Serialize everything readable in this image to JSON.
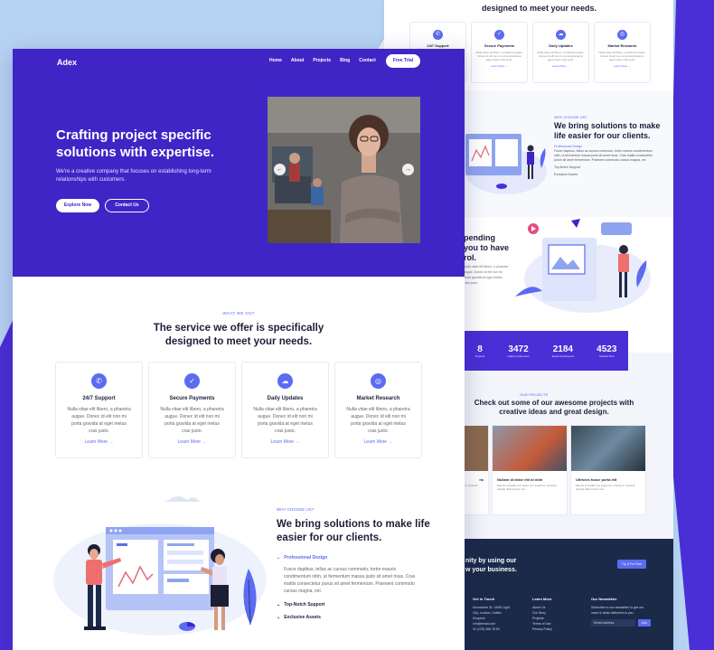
{
  "colors": {
    "primary": "#3f25c6",
    "accent": "#5b6cf0",
    "footer": "#1c2a4a"
  },
  "back": {
    "heading": "designed to meet your needs.",
    "cards": [
      {
        "icon": "phone-icon",
        "title": "24/7 Support",
        "desc": "Nulla vitae elit libero, a pharetra augue. Donec id elit non mi porta gravida at eget metus cras justo.",
        "link": "Learn More →"
      },
      {
        "icon": "shield-icon",
        "title": "Secure Payments",
        "desc": "Nulla vitae elit libero, a pharetra augue. Donec id elit non mi porta gravida at eget metus cras justo.",
        "link": "Learn More →"
      },
      {
        "icon": "cloud-icon",
        "title": "Daily Updates",
        "desc": "Nulla vitae elit libero, a pharetra augue. Donec id elit non mi porta gravida at eget metus cras justo.",
        "link": "Learn More →"
      },
      {
        "icon": "chart-icon",
        "title": "Market Research",
        "desc": "Nulla vitae elit libero, a pharetra augue. Donec id elit non mi porta gravida at eget metus cras justo.",
        "link": "Learn More →"
      }
    ],
    "why_small": "WHY CHOOSE US?",
    "why_title": "We bring solutions to make life easier for our clients.",
    "why_list": [
      "Professional Design",
      "Fusce dapibus, tellus ac cursus commodo, tortor mauris condimentum nibh, ut fermentum massa justo sit amet risus. Cras mattis consectetur purus sit amet fermentum. Praesent commodo cursus magna, vel.",
      "Top-Notch Support",
      "Exclusive Assets"
    ],
    "pend_title": "pending\nyou to have\nrol.",
    "pend_desc": "Nulla vitae elit libero, a pharetra augue. Donec id elit non mi porta gravida at eget metus cras justo.",
    "stats": [
      {
        "n": "8",
        "c": "Projects"
      },
      {
        "n": "3472",
        "c": "Happy Customers"
      },
      {
        "n": "2184",
        "c": "Expert Employees"
      },
      {
        "n": "4523",
        "c": "Awards Won"
      }
    ],
    "proj_small": "OUR PROJECTS",
    "proj_title": "Check out some of our awesome projects with creative ideas and great design.",
    "projects": [
      {
        "t": "ns",
        "d": "Mauris convallis non ligula non interdum. Gravida mauris."
      },
      {
        "t": "Nullam id dolor elit id nibh",
        "d": "Mauris convallis non ligula non interdum. Gravida aufugit ullamcorper nisi."
      },
      {
        "t": "Ultricies fusce porta elit",
        "d": "Mauris convallis non ligula non interdum. Gravida aufugit ullamcorper nisi."
      }
    ],
    "footer_cta": "nity by using our\nw your business.",
    "footer_btn": "Try It For Free",
    "footer_cols": [
      {
        "h": "Get in Touch",
        "items": [
          "Moonshine St. 14/05 Light City, London, United Kingdom",
          "info@email.com",
          "00 (123) 456 78 90"
        ]
      },
      {
        "h": "Learn More",
        "items": [
          "About Us",
          "Our Story",
          "Projects",
          "Terms of Use",
          "Privacy Policy"
        ]
      },
      {
        "h": "Our Newsletter",
        "items": [
          "Subscribe to our newsletter to get our news & deals delivered to you.",
          "Email Address",
          "Join"
        ]
      }
    ]
  },
  "front": {
    "logo": "Adex",
    "nav": [
      "Home",
      "About",
      "Projects",
      "Blog",
      "Contact"
    ],
    "trial": "Free Trial",
    "hero_title": "Crafting project specific solutions with expertise.",
    "hero_desc": "We're a creative company that focuses on establishing long-term relationships with customers.",
    "btn_explore": "Explore Now",
    "btn_contact": "Contact Us",
    "arrow_left": "←",
    "arrow_right": "→",
    "svc_small": "WHAT WE DO?",
    "svc_title": "The service we offer is specifically designed to meet your needs.",
    "cards": [
      {
        "icon": "✆",
        "title": "24/7 Support",
        "desc": "Nulla vitae elit libero, a pharetra augue. Donec id elit non mi porta gravida at eget metus cras justo.",
        "link": "Learn More →"
      },
      {
        "icon": "✓",
        "title": "Secure Payments",
        "desc": "Nulla vitae elit libero, a pharetra augue. Donec id elit non mi porta gravida at eget metus cras justo.",
        "link": "Learn More →"
      },
      {
        "icon": "☁",
        "title": "Daily Updates",
        "desc": "Nulla vitae elit libero, a pharetra augue. Donec id elit non mi porta gravida at eget metus cras justo.",
        "link": "Learn More →"
      },
      {
        "icon": "◎",
        "title": "Market Research",
        "desc": "Nulla vitae elit libero, a pharetra augue. Donec id elit non mi porta gravida at eget metus cras justo.",
        "link": "Learn More →"
      }
    ],
    "why_small": "WHY CHOOSE US?",
    "why_title": "We bring solutions to make life easier for our clients.",
    "why_items": [
      "Professional Design",
      "Top-Notch Support",
      "Exclusive Assets"
    ],
    "why_desc": "Fusce dapibus, tellus ac cursus commodo, tortor mauris condimentum nibh, ut fermentum massa justo sit amet risus. Cras mattis consectetur purus sit amet fermentum. Praesent commodo cursus magna, vel.",
    "chev": "⌄"
  }
}
